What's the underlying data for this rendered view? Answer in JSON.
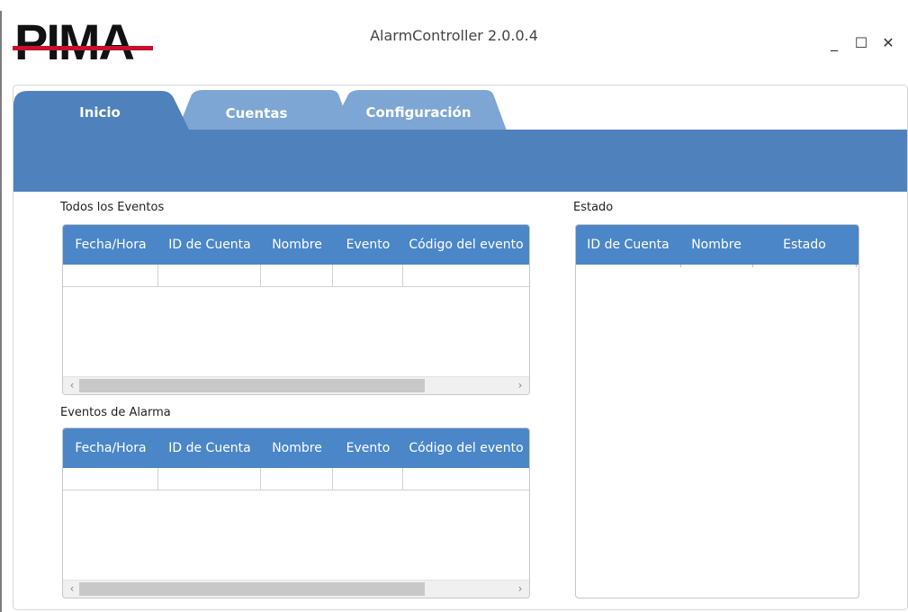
{
  "app": {
    "logo_text": "PIMA",
    "title": "AlarmController 2.0.0.4",
    "window_controls": {
      "minimize": "_",
      "maximize": "☐",
      "close": "✕"
    }
  },
  "tabs": [
    {
      "label": "Inicio",
      "active": true
    },
    {
      "label": "Cuentas",
      "active": false
    },
    {
      "label": "Configuración",
      "active": false
    }
  ],
  "colors": {
    "accent": "#4f81bd",
    "header": "#4b86c8",
    "tab_inactive": "#7ea6d4",
    "logo_red": "#c8102e"
  },
  "events": {
    "title": "Todos los Eventos",
    "columns": [
      "Fecha/Hora",
      "ID de Cuenta",
      "Nombre",
      "Evento",
      "Código del evento"
    ]
  },
  "alarms": {
    "title": "Eventos de Alarma",
    "columns": [
      "Fecha/Hora",
      "ID de Cuenta",
      "Nombre",
      "Evento",
      "Código del evento"
    ]
  },
  "status": {
    "title": "Estado",
    "columns": [
      "ID de Cuenta",
      "Nombre",
      "Estado"
    ]
  },
  "scrollbar": {
    "left": "‹",
    "right": "›"
  }
}
